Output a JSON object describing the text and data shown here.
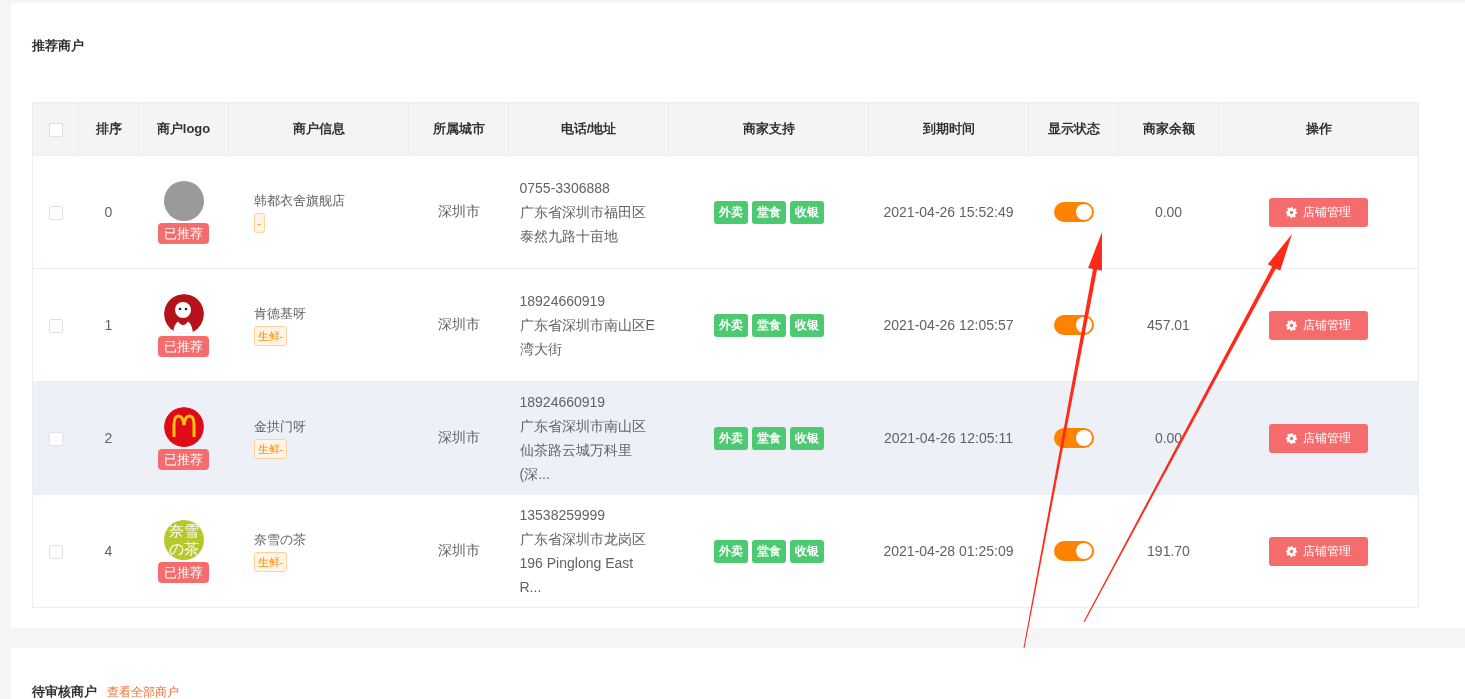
{
  "section_title": "推荐商户",
  "table": {
    "select_all": {
      "checked": false
    },
    "columns": [
      "排序",
      "商户logo",
      "商户信息",
      "所属城市",
      "电话/地址",
      "商家支持",
      "到期时间",
      "显示状态",
      "商家余额",
      "操作"
    ],
    "rows": [
      {
        "checked": false,
        "highlighted": false,
        "sort": "0",
        "logo": {
          "kind": "photo"
        },
        "badge": "已推荐",
        "name": "韩都衣舍旗舰店",
        "category": "-",
        "city": "深圳市",
        "phone": "0755-3306888",
        "address": "广东省深圳市福田区泰然九路十亩地",
        "support": [
          "外卖",
          "堂食",
          "收银"
        ],
        "expires": "2021-04-26 15:52:49",
        "on": true,
        "balance": "0.00",
        "action": "店铺管理"
      },
      {
        "checked": false,
        "highlighted": false,
        "sort": "1",
        "logo": {
          "kind": "kfc"
        },
        "badge": "已推荐",
        "name": "肯德基呀",
        "category": "生鲜-",
        "city": "深圳市",
        "phone": "18924660919",
        "address": "广东省深圳市南山区E湾大街",
        "support": [
          "外卖",
          "堂食",
          "收银"
        ],
        "expires": "2021-04-26 12:05:57",
        "on": true,
        "balance": "457.01",
        "action": "店铺管理"
      },
      {
        "checked": false,
        "highlighted": true,
        "sort": "2",
        "logo": {
          "kind": "arches"
        },
        "badge": "已推荐",
        "name": "金拱门呀",
        "category": "生鲜-",
        "city": "深圳市",
        "phone": "18924660919",
        "address": "广东省深圳市南山区仙茶路云城万科里(深...",
        "support": [
          "外卖",
          "堂食",
          "收银"
        ],
        "expires": "2021-04-26 12:05:11",
        "on": true,
        "balance": "0.00",
        "action": "店铺管理"
      },
      {
        "checked": false,
        "highlighted": false,
        "sort": "4",
        "logo": {
          "kind": "text",
          "text": "奈雪の茶"
        },
        "badge": "已推荐",
        "name": "奈雪の茶",
        "category": "生鲜-",
        "city": "深圳市",
        "phone": "13538259999",
        "address": "广东省深圳市龙岗区196 Pinglong East R...",
        "support": [
          "外卖",
          "堂食",
          "收银"
        ],
        "expires": "2021-04-28 01:25:09",
        "on": true,
        "balance": "191.70",
        "action": "店铺管理"
      }
    ]
  },
  "pending": {
    "title": "待审核商户",
    "link": "查看全部商户"
  }
}
